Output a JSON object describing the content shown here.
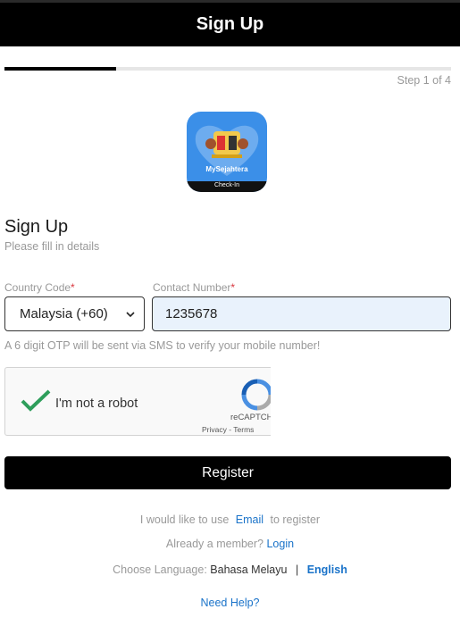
{
  "header": {
    "title": "Sign Up"
  },
  "progress": {
    "fraction": 0.25,
    "step_label": "Step 1 of 4"
  },
  "logo": {
    "name": "MySejahtera app logo",
    "lines": [
      "MySejahtera",
      "Check-In"
    ]
  },
  "form": {
    "title": "Sign Up",
    "subtitle": "Please fill in details",
    "country_code": {
      "label": "Country Code",
      "required_mark": "*",
      "value": "Malaysia (+60)"
    },
    "contact_number": {
      "label": "Contact Number",
      "required_mark": "*",
      "value": "1235678"
    },
    "hint": "A 6 digit OTP will be sent via SMS to verify your mobile number!"
  },
  "recaptcha": {
    "label": "I'm not a robot",
    "checked": true,
    "brand": "reCAPTCHA",
    "links": "Privacy - Terms"
  },
  "register_button": "Register",
  "alt_register": {
    "prefix": "I would like to use",
    "link": "Email",
    "suffix": "to register"
  },
  "member": {
    "text": "Already a member?",
    "link": "Login"
  },
  "language": {
    "label": "Choose Language:",
    "option_1": "Bahasa Melayu",
    "separator": "|",
    "option_2": "English",
    "selected": "English"
  },
  "help_link": "Need Help?",
  "colors": {
    "accent": "#000000",
    "link": "#1a73c9",
    "input_bg": "#e9f2fc",
    "logo_bg": "#3b8fe8",
    "check": "#2e9e5b"
  }
}
